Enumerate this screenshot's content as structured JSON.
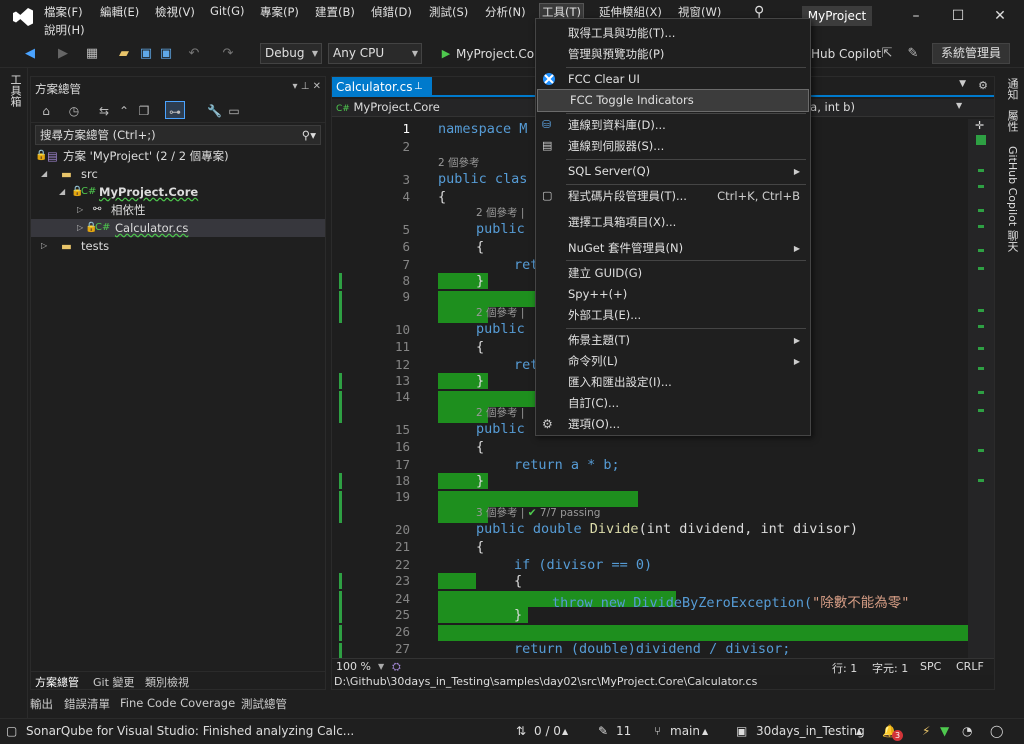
{
  "titlebar": {
    "menus": [
      "檔案(F)",
      "編輯(E)",
      "檢視(V)",
      "Git(G)",
      "專案(P)",
      "建置(B)",
      "偵錯(D)",
      "測試(S)",
      "分析(N)",
      "工具(T)",
      "延伸模組(X)",
      "視窗(W)"
    ],
    "menu_help": "說明(H)",
    "search_icon": "⚲",
    "project": "MyProject",
    "minimize": "–",
    "maximize": "☐",
    "close": "✕"
  },
  "toolbar": {
    "config": "Debug",
    "platform": "Any CPU",
    "run_target": "MyProject.Core",
    "copilot": "Hub Copilot",
    "admin": "系統管理員"
  },
  "left_strip": "工具箱",
  "right_strip": {
    "notify": "通知",
    "props": "屬性",
    "copilot": "GitHub Copilot 聊天"
  },
  "solution": {
    "title": "方案總管",
    "search_placeholder": "搜尋方案總管 (Ctrl+;)",
    "tree": [
      {
        "label": "方案 'MyProject' (2 / 2 個專案)"
      },
      {
        "label": "src"
      },
      {
        "label": "MyProject.Core"
      },
      {
        "label": "相依性"
      },
      {
        "label": "Calculator.cs"
      },
      {
        "label": "tests"
      }
    ],
    "tabs": [
      "方案總管",
      "Git 變更",
      "類別檢視"
    ]
  },
  "editor": {
    "tab": "Calculator.cs",
    "nav_left": "MyProject.Core",
    "nav_right": "t a, int b)",
    "zoom": "100 %",
    "line": "行: 1",
    "col": "字元: 1",
    "spc": "SPC",
    "crlf": "CRLF",
    "path": "D:\\Github\\30days_in_Testing\\samples\\day02\\src\\MyProject.Core\\Calculator.cs",
    "refs2": "2 個參考",
    "refs3": "3 個參考",
    "passing": "7/7 passing",
    "lens2_pipe": "2 個參考 |"
  },
  "code": {
    "l1": "namespace M",
    "l3": "public clas",
    "l4": "{",
    "l5": "public",
    "l6": "{",
    "l7": "ret",
    "l8": "}",
    "l10": "public",
    "l11": "{",
    "l12": "ret",
    "l13": "}",
    "l15": "public",
    "l16": "{",
    "l17": "return a * b;",
    "l18": "}",
    "l20a": "public double ",
    "l20b": "Divide",
    "l20c": "(int dividend, int divisor)",
    "l21": "{",
    "l22": "if (divisor == 0)",
    "l23": "{",
    "l24a": "throw new DivideByZeroException(",
    "l24b": "\"除數不能為零\"",
    "l25": "}",
    "l27": "return (double)dividend / divisor;"
  },
  "bottom_tabs": [
    "輸出",
    "錯誤清單",
    "Fine Code Coverage",
    "測試總管"
  ],
  "statusbar": {
    "message": "SonarQube for Visual Studio: Finished analyzing Calc...",
    "sync": "0 / 0",
    "pencil": "11",
    "branch": "main",
    "repo": "30days_in_Testing",
    "bell_count": "3"
  },
  "dropdown": {
    "items": [
      {
        "label": "取得工具與功能(T)..."
      },
      {
        "label": "管理與預覽功能(P)"
      },
      {
        "label": "FCC Clear UI"
      },
      {
        "label": "FCC Toggle Indicators"
      },
      {
        "label": "連線到資料庫(D)..."
      },
      {
        "label": "連線到伺服器(S)..."
      },
      {
        "label": "SQL Server(Q)"
      },
      {
        "label": "程式碼片段管理員(T)...",
        "shortcut": "Ctrl+K, Ctrl+B"
      },
      {
        "label": "選擇工具箱項目(X)..."
      },
      {
        "label": "NuGet 套件管理員(N)"
      },
      {
        "label": "建立 GUID(G)"
      },
      {
        "label": "Spy++(+)"
      },
      {
        "label": "外部工具(E)..."
      },
      {
        "label": "佈景主題(T)"
      },
      {
        "label": "命令列(L)"
      },
      {
        "label": "匯入和匯出設定(I)..."
      },
      {
        "label": "自訂(C)..."
      },
      {
        "label": "選項(O)..."
      }
    ]
  },
  "colors": {
    "accent": "#007acc",
    "highlight": "#1e8f1e",
    "vs_purple": "#8661c5"
  }
}
